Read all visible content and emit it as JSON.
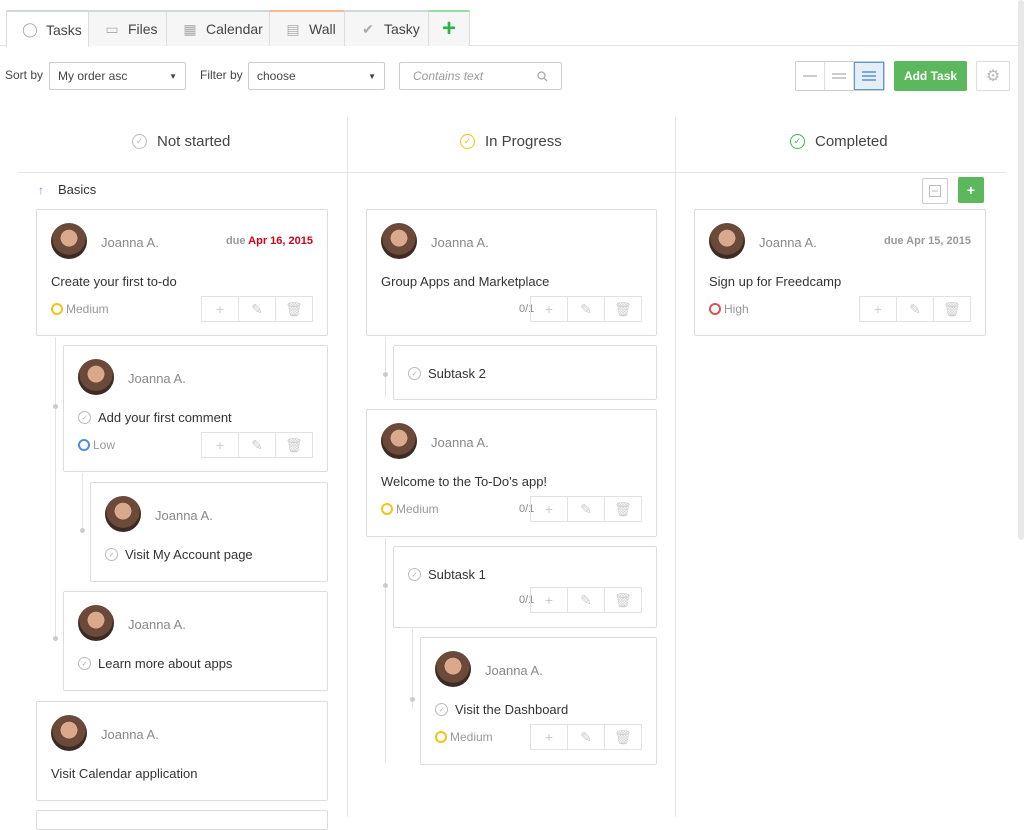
{
  "tabs": [
    {
      "label": "Tasks",
      "icon": "check-circle-icon"
    },
    {
      "label": "Files",
      "icon": "folder-icon"
    },
    {
      "label": "Calendar",
      "icon": "calendar-icon"
    },
    {
      "label": "Wall",
      "icon": "wall-icon"
    },
    {
      "label": "Tasky",
      "icon": "checkmark-icon"
    },
    {
      "label": "+",
      "icon": "plus-icon"
    }
  ],
  "toolbar": {
    "sort_label": "Sort by",
    "sort_value": "My order asc",
    "filter_label": "Filter by",
    "filter_value": "choose",
    "search_placeholder": "Contains text",
    "add_task": "Add Task"
  },
  "columns": {
    "not_started": "Not started",
    "in_progress": "In Progress",
    "completed": "Completed"
  },
  "group": {
    "label": "Basics"
  },
  "colors": {
    "accent_green": "#5cb85c",
    "due_red": "#d0021b",
    "medium": "#f5c518",
    "low": "#4a90d9",
    "high": "#d9534f"
  },
  "cards": {
    "c1": {
      "author": "Joanna A.",
      "due_prefix": "due",
      "due_date": "Apr 16, 2015",
      "title": "Create your first to-do",
      "priority": "Medium"
    },
    "c1a": {
      "author": "Joanna A.",
      "title": "Add your first comment",
      "priority": "Low"
    },
    "c1a1": {
      "author": "Joanna A.",
      "title": "Visit My Account page"
    },
    "c1b": {
      "author": "Joanna A.",
      "title": "Learn more about apps"
    },
    "c2": {
      "author": "Joanna A.",
      "title": "Visit Calendar application"
    },
    "p1": {
      "author": "Joanna A.",
      "title": "Group Apps and Marketplace",
      "count": "0/1"
    },
    "p1a": {
      "title": "Subtask 2"
    },
    "p2": {
      "author": "Joanna A.",
      "title": "Welcome to the To-Do's app!",
      "priority": "Medium",
      "count": "0/1"
    },
    "p2a": {
      "title": "Subtask 1",
      "count": "0/1"
    },
    "p2a1": {
      "author": "Joanna A.",
      "title": "Visit the Dashboard",
      "priority": "Medium"
    },
    "d1": {
      "author": "Joanna A.",
      "due": "due Apr 15, 2015",
      "title": "Sign up for Freedcamp",
      "priority": "High"
    }
  }
}
